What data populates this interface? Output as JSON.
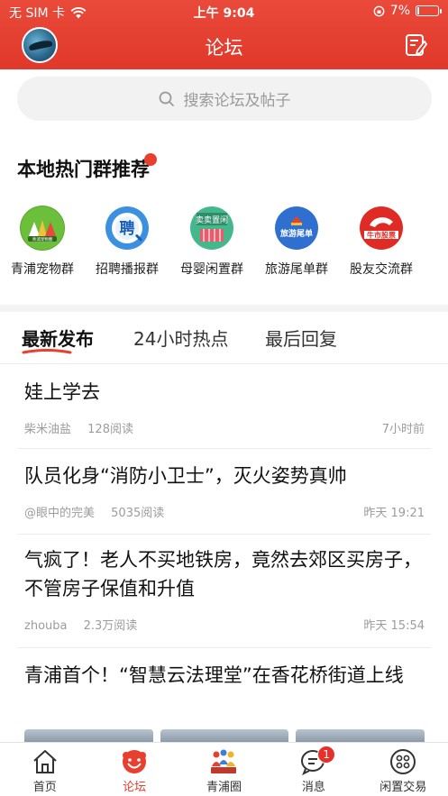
{
  "status_bar": {
    "carrier": "无 SIM 卡",
    "time": "上午 9:04",
    "battery": "7%",
    "battery_level": 0.07
  },
  "nav": {
    "title": "论坛"
  },
  "search": {
    "placeholder": "搜索论坛及帖子"
  },
  "groups": {
    "title": "本地热门群推荐",
    "items": [
      {
        "label": "青浦宠物群",
        "color": "#5aa832",
        "icon_text": "青浦宠物圈"
      },
      {
        "label": "招聘播报群",
        "color": "#2c7fd6",
        "icon_text": "聘"
      },
      {
        "label": "母婴闲置群",
        "color": "#3db48a",
        "icon_text": "卖卖置闲"
      },
      {
        "label": "旅游尾单群",
        "color": "#2a66c4",
        "icon_text": "旅游尾单"
      },
      {
        "label": "股友交流群",
        "color": "#e02a24",
        "icon_text": "牛市股票"
      }
    ]
  },
  "tabs": [
    {
      "label": "最新发布",
      "active": true
    },
    {
      "label": "24小时热点",
      "active": false
    },
    {
      "label": "最后回复",
      "active": false
    }
  ],
  "posts": [
    {
      "title": "娃上学去",
      "author": "柴米油盐",
      "reads": "128阅读",
      "time": "7小时前"
    },
    {
      "title": "队员化身“消防小卫士”，灭火姿势真帅",
      "author": "@眼中的完美",
      "reads": "5035阅读",
      "time": "昨天 19:21"
    },
    {
      "title": "气疯了！老人不买地铁房，竟然去郊区买房子，不管房子保值和升值",
      "author": "zhouba",
      "reads": "2.3万阅读",
      "time": "昨天 15:54"
    },
    {
      "title": "青浦首个！“智慧云法理堂”在香花桥街道上线"
    }
  ],
  "tabbar": [
    {
      "label": "首页",
      "icon": "home-icon",
      "active": false
    },
    {
      "label": "论坛",
      "icon": "forum-icon",
      "active": true
    },
    {
      "label": "青浦圈",
      "icon": "circle-icon",
      "active": false
    },
    {
      "label": "消息",
      "icon": "message-icon",
      "active": false,
      "badge": "1"
    },
    {
      "label": "闲置交易",
      "icon": "trade-icon",
      "active": false
    }
  ],
  "colors": {
    "brand": "#e8402e",
    "text_muted": "#9c9c9c"
  }
}
